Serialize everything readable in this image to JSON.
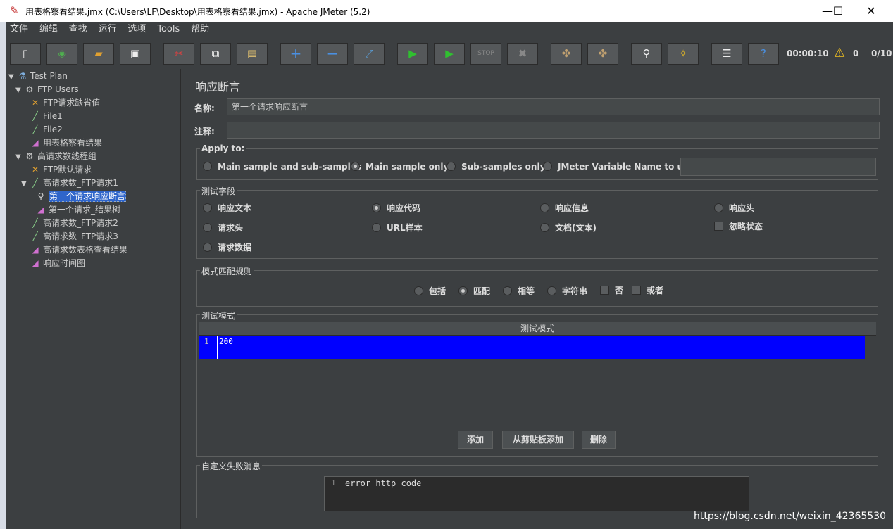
{
  "window": {
    "title": "用表格察看结果.jmx (C:\\Users\\LF\\Desktop\\用表格察看结果.jmx) - Apache JMeter (5.2)"
  },
  "menu": [
    "文件",
    "编辑",
    "查找",
    "运行",
    "选项",
    "Tools",
    "帮助"
  ],
  "toolbar": {
    "elapsed": "00:00:10",
    "warnings": "0",
    "threads": "0/10"
  },
  "tree": [
    {
      "label": "Test Plan"
    },
    {
      "label": "FTP Users"
    },
    {
      "label": "FTP请求缺省值"
    },
    {
      "label": "File1"
    },
    {
      "label": "File2"
    },
    {
      "label": "用表格察看结果"
    },
    {
      "label": "高请求数线程组"
    },
    {
      "label": "FTP默认请求"
    },
    {
      "label": "高请求数_FTP请求1"
    },
    {
      "label": "第一个请求响应断言"
    },
    {
      "label": "第一个请求_结果树"
    },
    {
      "label": "高请求数_FTP请求2"
    },
    {
      "label": "高请求数_FTP请求3"
    },
    {
      "label": "高请求数表格查看结果"
    },
    {
      "label": "响应时间图"
    }
  ],
  "panel": {
    "title": "响应断言",
    "name_label": "名称:",
    "name_value": "第一个请求响应断言",
    "comment_label": "注释:",
    "comment_value": "",
    "apply_to": {
      "legend": "Apply to:",
      "options": [
        "Main sample and sub-samples",
        "Main sample only",
        "Sub-samples only",
        "JMeter Variable Name to use"
      ],
      "selected": "Main sample only",
      "variable_value": ""
    },
    "test_field": {
      "legend": "测试字段",
      "options": [
        "响应文本",
        "响应代码",
        "响应信息",
        "响应头",
        "请求头",
        "URL样本",
        "文档(文本)",
        "请求数据"
      ],
      "selected": "响应代码",
      "ignore_status": "忽略状态"
    },
    "pattern_rules": {
      "legend": "模式匹配规则",
      "options": [
        "包括",
        "匹配",
        "相等",
        "字符串"
      ],
      "selected": "匹配",
      "not_label": "否",
      "or_label": "或者"
    },
    "patterns": {
      "legend": "测试模式",
      "column_header": "测试模式",
      "rows": [
        {
          "num": "1",
          "value": "200"
        }
      ],
      "add_button": "添加",
      "add_clipboard_button": "从剪贴板添加",
      "delete_button": "删除"
    },
    "custom_failure": {
      "legend": "自定义失败消息",
      "line_num": "1",
      "text": "error http code"
    }
  },
  "watermark": "https://blog.csdn.net/weixin_42365530"
}
